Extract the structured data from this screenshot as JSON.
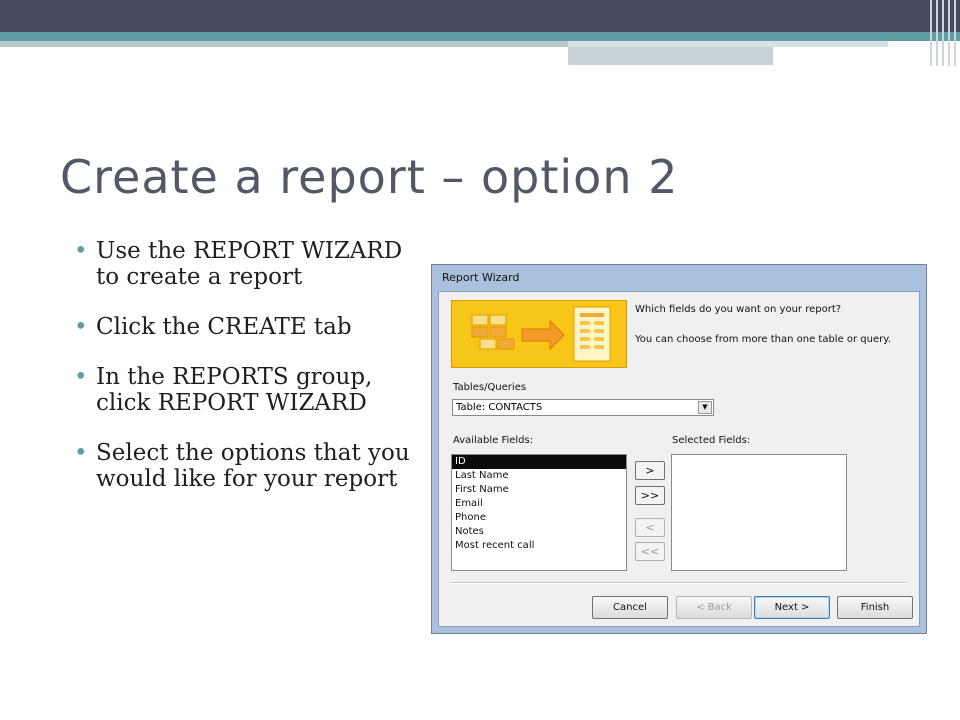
{
  "slide": {
    "title": "Create a report – option 2",
    "bullets": [
      "Use the REPORT WIZARD to create a report",
      "Click the CREATE tab",
      "In the REPORTS group, click REPORT WIZARD",
      "Select the options that you would like for your report"
    ]
  },
  "dialog": {
    "title": "Report Wizard",
    "prompt": "Which fields do you want on your report?",
    "prompt2": "You can choose from more than one table or query.",
    "tables_label": "Tables/Queries",
    "table_value": "Table: CONTACTS",
    "available_label": "Available Fields:",
    "selected_label": "Selected Fields:",
    "available_fields": [
      "ID",
      "Last Name",
      "First Name",
      "Email",
      "Phone",
      "Notes",
      "Most recent call"
    ],
    "selected_fields": [],
    "move_buttons": {
      "add_one": ">",
      "add_all": ">>",
      "remove_one": "<",
      "remove_all": "<<"
    },
    "buttons": {
      "cancel": "Cancel",
      "back": "< Back",
      "next": "Next >",
      "finish": "Finish"
    }
  },
  "colors": {
    "accent": "#5f9ca4",
    "title_text": "#535866",
    "top_bar": "#434a5e"
  }
}
